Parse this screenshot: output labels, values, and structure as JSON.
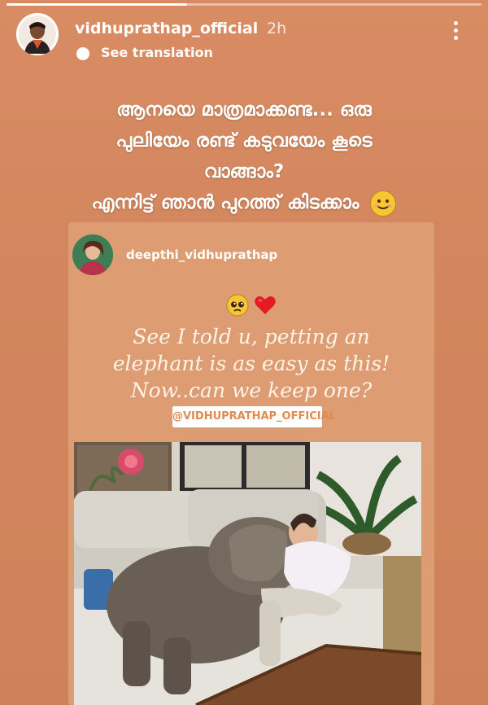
{
  "story": {
    "progress": 0.38,
    "username": "vidhuprathap_official",
    "time": "2h",
    "translate_label": "See translation",
    "caption_lines": [
      "ആനയെ മാത്രമാക്കണ്ട... ഒരു",
      "പുലിയേം രണ്ട് കടുവയേം കൂടെ",
      "വാങ്ങാം?",
      "എന്നിട്ട് ഞാൻ പുറത്ത് കിടക്കാം"
    ],
    "caption_emoji": "smiling-face-icon"
  },
  "shared_post": {
    "username": "deepthi_vidhuprathap",
    "emojis": [
      "pleading-face-icon",
      "red-heart-icon"
    ],
    "text_lines": [
      "See I told u, petting an",
      "elephant is as easy as this!",
      "Now..can we keep one?"
    ],
    "mention": "@VIDHUPRATHAP_OFFICIAL"
  },
  "colors": {
    "background": "#d4875f",
    "card": "#dd9c71",
    "mention_text": "#e08a4f"
  }
}
